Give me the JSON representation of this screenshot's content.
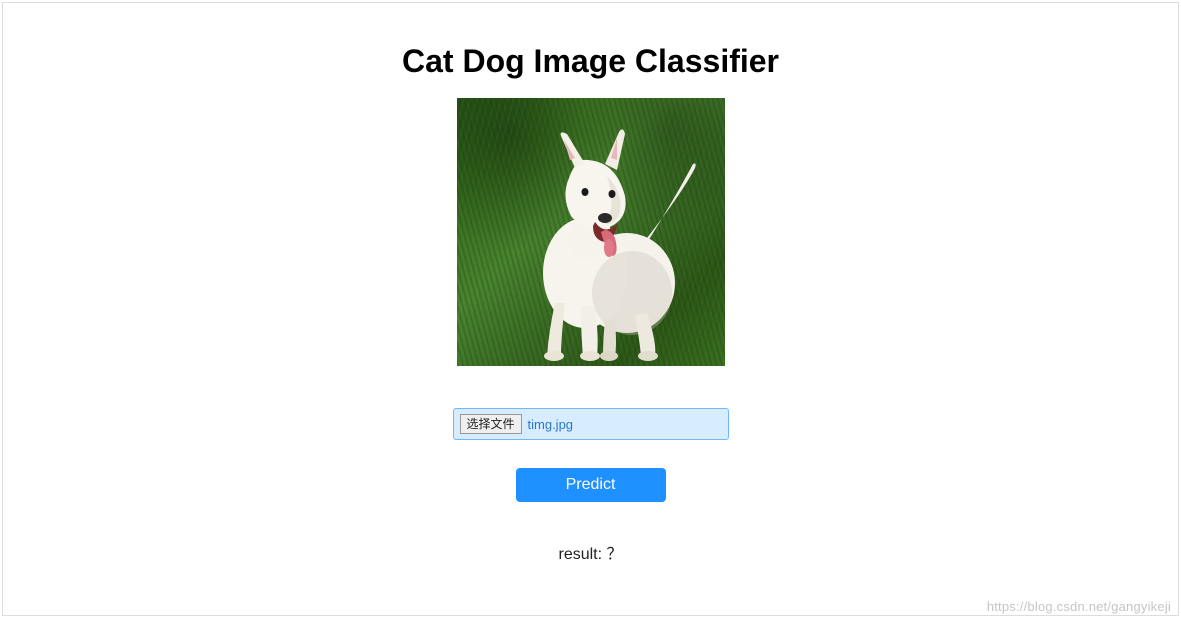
{
  "header": {
    "title": "Cat Dog Image Classifier"
  },
  "preview": {
    "alt": "white bull terrier dog standing on green grass"
  },
  "file_input": {
    "choose_label": "选择文件",
    "selected_file": "timg.jpg"
  },
  "actions": {
    "predict_label": "Predict"
  },
  "result": {
    "label": "result: ",
    "value": "？"
  },
  "watermark": "https://blog.csdn.net/gangyikeji"
}
